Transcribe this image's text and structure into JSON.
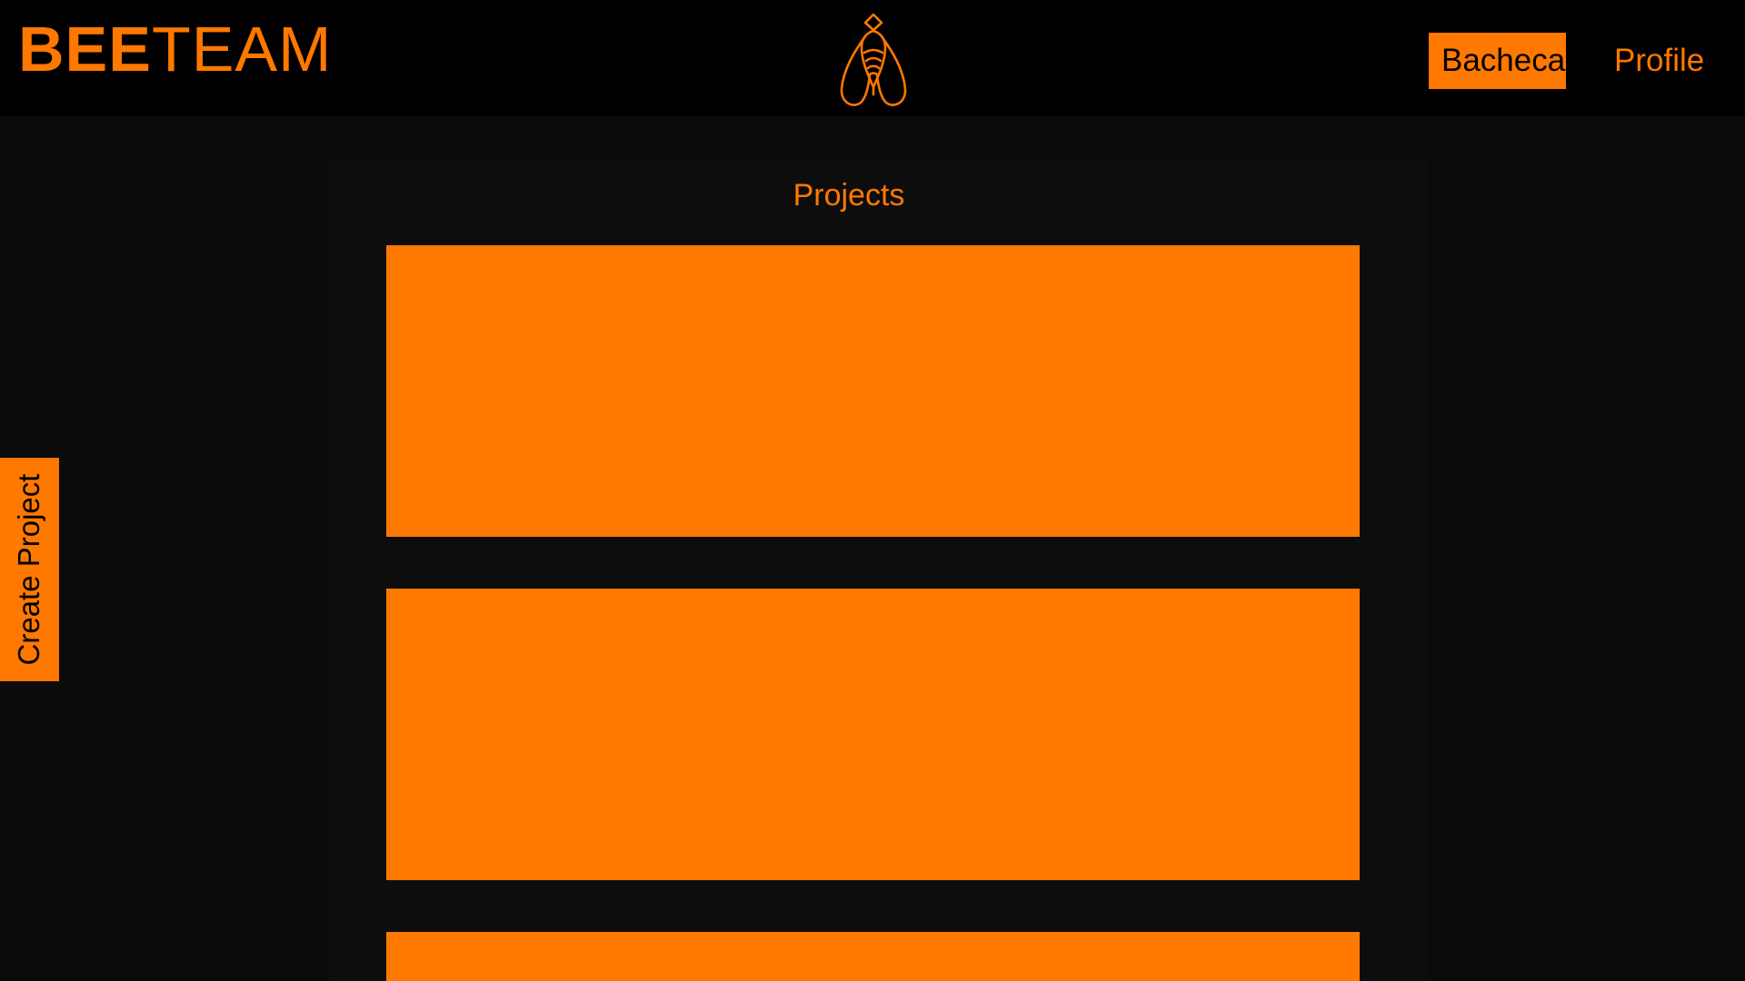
{
  "header": {
    "brand_bold": "BEE",
    "brand_light": "TEAM",
    "logo_icon": "bee-icon",
    "nav": [
      {
        "label": "Bacheca",
        "active": true
      },
      {
        "label": "Profile",
        "active": false
      }
    ]
  },
  "main": {
    "title": "Projects",
    "cards": 3
  },
  "sidebar": {
    "create_label": "Create Project"
  },
  "colors": {
    "accent": "#ff7800",
    "background": "#0b0b0b",
    "topbar": "#000000"
  }
}
